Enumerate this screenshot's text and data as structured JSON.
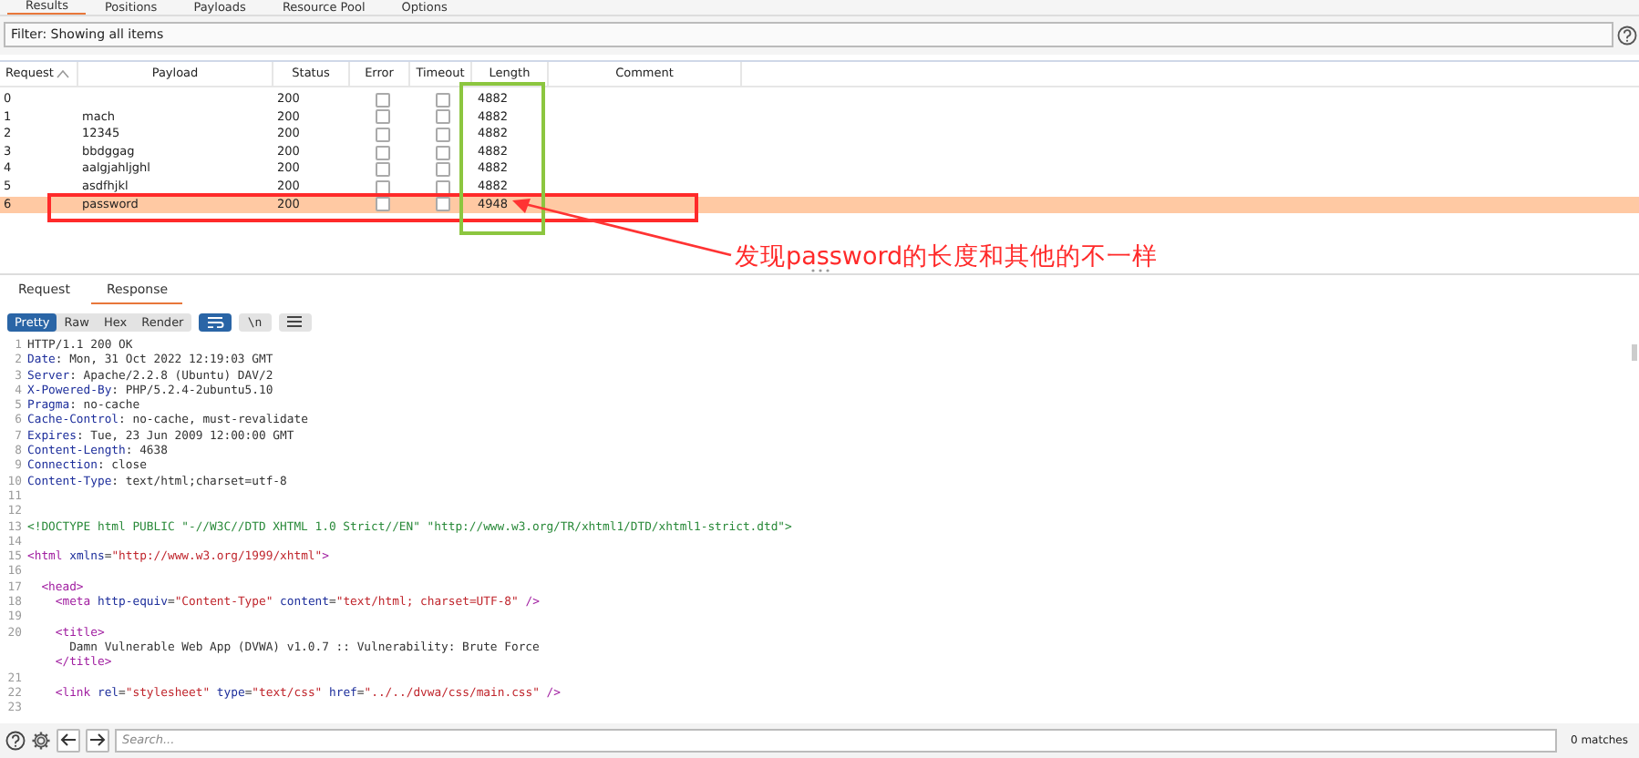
{
  "top_tabs": [
    {
      "label": "Results",
      "selected": true
    },
    {
      "label": "Positions",
      "selected": false
    },
    {
      "label": "Payloads",
      "selected": false
    },
    {
      "label": "Resource Pool",
      "selected": false
    },
    {
      "label": "Options",
      "selected": false
    }
  ],
  "filter": {
    "value": "Filter: Showing all items"
  },
  "results_table": {
    "columns": [
      {
        "label": "Request",
        "sorted": true
      },
      {
        "label": "Payload",
        "sorted": false
      },
      {
        "label": "Status",
        "sorted": false
      },
      {
        "label": "Error",
        "sorted": false
      },
      {
        "label": "Timeout",
        "sorted": false
      },
      {
        "label": "Length",
        "sorted": false
      },
      {
        "label": "Comment",
        "sorted": false
      }
    ],
    "rows": [
      {
        "request": "0",
        "status": "200",
        "error": false,
        "timeout": false,
        "length": "4882",
        "selected": false
      },
      {
        "request": "1",
        "payload": "mach",
        "status": "200",
        "error": false,
        "timeout": false,
        "length": "4882",
        "selected": false
      },
      {
        "request": "2",
        "payload": "12345",
        "status": "200",
        "error": false,
        "timeout": false,
        "length": "4882",
        "selected": false
      },
      {
        "request": "3",
        "payload": "bbdggag",
        "status": "200",
        "error": false,
        "timeout": false,
        "length": "4882",
        "selected": false
      },
      {
        "request": "4",
        "payload": "aalgjahljghl",
        "status": "200",
        "error": false,
        "timeout": false,
        "length": "4882",
        "selected": false
      },
      {
        "request": "5",
        "payload": "asdfhjkl",
        "status": "200",
        "error": false,
        "timeout": false,
        "length": "4882",
        "selected": false
      },
      {
        "request": "6",
        "payload": "password",
        "status": "200",
        "error": false,
        "timeout": false,
        "length": "4948",
        "selected": true
      }
    ]
  },
  "annotation": {
    "text": "发现password的长度和其他的不一样"
  },
  "message_tabs": [
    {
      "label": "Request",
      "selected": false
    },
    {
      "label": "Response",
      "selected": true
    }
  ],
  "view_modes": [
    {
      "label": "Pretty",
      "selected": true
    },
    {
      "label": "Raw",
      "selected": false
    },
    {
      "label": "Hex",
      "selected": false
    },
    {
      "label": "Render",
      "selected": false
    }
  ],
  "toolbar_toggles": [
    {
      "kind": "wrap",
      "on": true
    },
    {
      "kind": "newline",
      "label": "\\n",
      "on": false
    },
    {
      "kind": "menu",
      "on": false
    }
  ],
  "code_lines": [
    {
      "number": "1",
      "segments": [
        {
          "kind": "plain",
          "text": "HTTP/1.1 200 OK"
        }
      ]
    },
    {
      "number": "2",
      "segments": [
        {
          "kind": "key",
          "text": "Date"
        },
        {
          "kind": "plain",
          "text": ": Mon, 31 Oct 2022 12:19:03 GMT"
        }
      ]
    },
    {
      "number": "3",
      "segments": [
        {
          "kind": "key",
          "text": "Server"
        },
        {
          "kind": "plain",
          "text": ": Apache/2.2.8 (Ubuntu) DAV/2"
        }
      ]
    },
    {
      "number": "4",
      "segments": [
        {
          "kind": "key",
          "text": "X-Powered-By"
        },
        {
          "kind": "plain",
          "text": ": PHP/5.2.4-2ubuntu5.10"
        }
      ]
    },
    {
      "number": "5",
      "segments": [
        {
          "kind": "key",
          "text": "Pragma"
        },
        {
          "kind": "plain",
          "text": ": no-cache"
        }
      ]
    },
    {
      "number": "6",
      "segments": [
        {
          "kind": "key",
          "text": "Cache-Control"
        },
        {
          "kind": "plain",
          "text": ": no-cache, must-revalidate"
        }
      ]
    },
    {
      "number": "7",
      "segments": [
        {
          "kind": "key",
          "text": "Expires"
        },
        {
          "kind": "plain",
          "text": ": Tue, 23 Jun 2009 12:00:00 GMT"
        }
      ]
    },
    {
      "number": "8",
      "segments": [
        {
          "kind": "key",
          "text": "Content-Length"
        },
        {
          "kind": "plain",
          "text": ": 4638"
        }
      ]
    },
    {
      "number": "9",
      "segments": [
        {
          "kind": "key",
          "text": "Connection"
        },
        {
          "kind": "plain",
          "text": ": close"
        }
      ]
    },
    {
      "number": "10",
      "segments": [
        {
          "kind": "key",
          "text": "Content-Type"
        },
        {
          "kind": "plain",
          "text": ": text/html;charset=utf-8"
        }
      ]
    },
    {
      "number": "11"
    },
    {
      "number": "12"
    },
    {
      "number": "13",
      "segments": [
        {
          "kind": "doctype",
          "text": "<!DOCTYPE html PUBLIC \"-//W3C//DTD XHTML 1.0 Strict//EN\" \"http://www.w3.org/TR/xhtml1/DTD/xhtml1-strict.dtd\">"
        }
      ]
    },
    {
      "number": "14"
    },
    {
      "number": "15",
      "segments": [
        {
          "kind": "tag",
          "text": "<html"
        },
        {
          "kind": "attr",
          "text": " xmlns"
        },
        {
          "kind": "plain",
          "text": "="
        },
        {
          "kind": "string",
          "text": "\"http://www.w3.org/1999/xhtml\""
        },
        {
          "kind": "tag",
          "text": ">"
        }
      ]
    },
    {
      "number": "16"
    },
    {
      "number": "17",
      "segments": [
        {
          "kind": "tag",
          "text": "  <head>"
        }
      ]
    },
    {
      "number": "18",
      "segments": [
        {
          "kind": "tag",
          "text": "    <meta"
        },
        {
          "kind": "attr",
          "text": " http-equiv"
        },
        {
          "kind": "plain",
          "text": "="
        },
        {
          "kind": "string",
          "text": "\"Content-Type\""
        },
        {
          "kind": "attr",
          "text": " content"
        },
        {
          "kind": "plain",
          "text": "="
        },
        {
          "kind": "string",
          "text": "\"text/html; charset=UTF-8\""
        },
        {
          "kind": "tag",
          "text": " />"
        }
      ]
    },
    {
      "number": "19"
    },
    {
      "number": "20",
      "segments": [
        {
          "kind": "tag",
          "text": "    <title>"
        }
      ]
    },
    {
      "segments": [
        {
          "kind": "plain",
          "text": "      Damn Vulnerable Web App (DVWA) v1.0.7 :: Vulnerability: Brute Force"
        }
      ]
    },
    {
      "segments": [
        {
          "kind": "tag",
          "text": "    </title>"
        }
      ]
    },
    {
      "number": "21"
    },
    {
      "number": "22",
      "segments": [
        {
          "kind": "tag",
          "text": "    <link"
        },
        {
          "kind": "attr",
          "text": " rel"
        },
        {
          "kind": "plain",
          "text": "="
        },
        {
          "kind": "string",
          "text": "\"stylesheet\""
        },
        {
          "kind": "attr",
          "text": " type"
        },
        {
          "kind": "plain",
          "text": "="
        },
        {
          "kind": "string",
          "text": "\"text/css\""
        },
        {
          "kind": "attr",
          "text": " href"
        },
        {
          "kind": "plain",
          "text": "="
        },
        {
          "kind": "string",
          "text": "\"../../dvwa/css/main.css\""
        },
        {
          "kind": "tag",
          "text": " />"
        }
      ]
    },
    {
      "number": "23"
    }
  ],
  "search": {
    "placeholder": "Search..."
  },
  "match_count": "0 matches"
}
